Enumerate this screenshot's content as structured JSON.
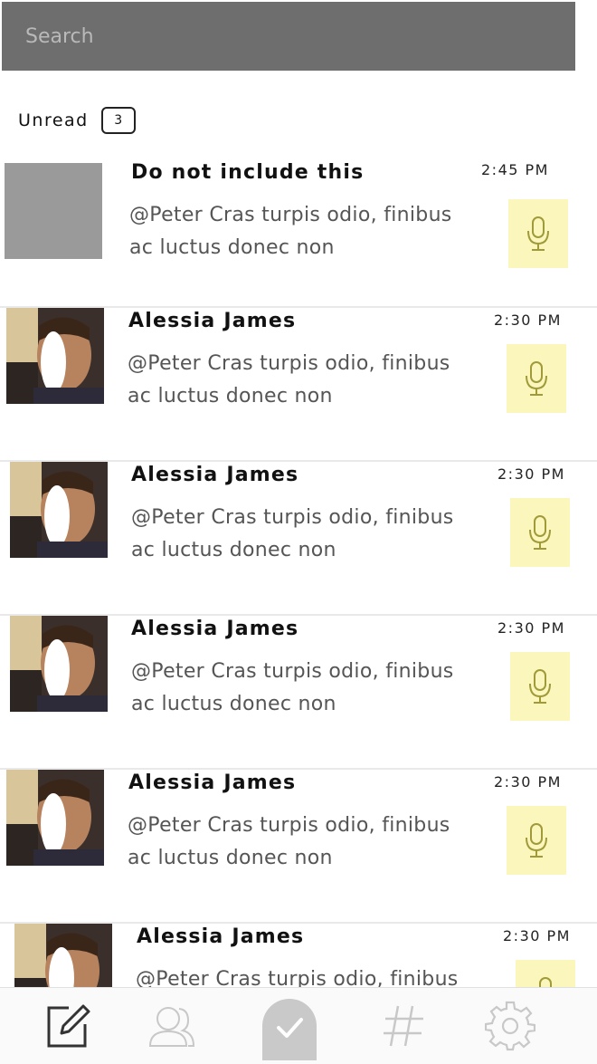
{
  "search": {
    "placeholder": "Search"
  },
  "unread": {
    "label": "Unread",
    "count": "3"
  },
  "messages": [
    {
      "name": "Do not include this",
      "text": "@Peter Cras turpis odio, finibus ac luctus donec non",
      "time": "2:45 PM",
      "avatar": "placeholder"
    },
    {
      "name": "Alessia James",
      "text": "@Peter Cras turpis odio, finibus ac luctus donec non",
      "time": "2:30 PM",
      "avatar": "photo"
    },
    {
      "name": "Alessia James",
      "text": "@Peter Cras turpis odio, finibus ac luctus donec non",
      "time": "2:30 PM",
      "avatar": "photo"
    },
    {
      "name": "Alessia James",
      "text": "@Peter Cras turpis odio, finibus ac luctus donec non",
      "time": "2:30 PM",
      "avatar": "photo"
    },
    {
      "name": "Alessia James",
      "text": "@Peter Cras turpis odio, finibus ac luctus donec non",
      "time": "2:30 PM",
      "avatar": "photo"
    },
    {
      "name": "Alessia James",
      "text": "@Peter Cras turpis odio, finibus",
      "time": "2:30 PM",
      "avatar": "photo"
    }
  ],
  "tabbar": {
    "items": [
      {
        "icon": "compose-icon",
        "active": true
      },
      {
        "icon": "contacts-icon",
        "active": false
      },
      {
        "icon": "checkmark-icon",
        "active": false
      },
      {
        "icon": "hashtag-icon",
        "active": false
      },
      {
        "icon": "settings-gear-icon",
        "active": false
      }
    ]
  },
  "colors": {
    "search_bg": "#6e6e6e",
    "mic_bg": "#fbf7bc",
    "mic_icon": "#a09a3a",
    "separator": "#e9e9e9"
  }
}
